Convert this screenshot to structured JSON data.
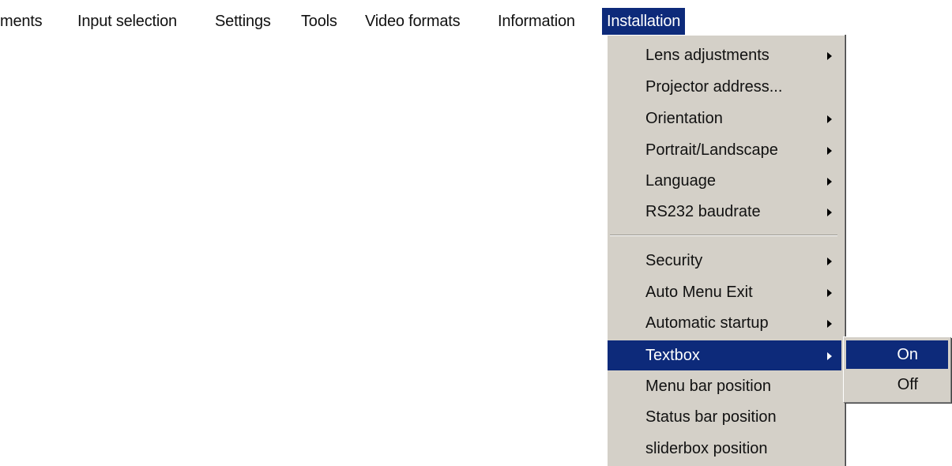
{
  "menubar": {
    "items": [
      {
        "label": "ments"
      },
      {
        "label": "Input selection"
      },
      {
        "label": "Settings"
      },
      {
        "label": "Tools"
      },
      {
        "label": "Video formats"
      },
      {
        "label": "Information"
      },
      {
        "label": "Installation"
      }
    ],
    "active_index": 6
  },
  "dropdown": {
    "items": [
      {
        "label": "Lens adjustments",
        "has_submenu": true
      },
      {
        "label": "Projector address...",
        "has_submenu": false
      },
      {
        "label": "Orientation",
        "has_submenu": true
      },
      {
        "label": "Portrait/Landscape",
        "has_submenu": true
      },
      {
        "label": "Language",
        "has_submenu": true
      },
      {
        "label": "RS232 baudrate",
        "has_submenu": true
      },
      {
        "label": "Security",
        "has_submenu": true
      },
      {
        "label": "Auto Menu Exit",
        "has_submenu": true
      },
      {
        "label": "Automatic startup",
        "has_submenu": true
      },
      {
        "label": "Textbox",
        "has_submenu": true,
        "selected": true
      },
      {
        "label": "Menu bar position",
        "has_submenu": false
      },
      {
        "label": "Status bar position",
        "has_submenu": false
      },
      {
        "label": "sliderbox position",
        "has_submenu": false
      }
    ]
  },
  "submenu": {
    "items": [
      {
        "label": "On",
        "selected": true
      },
      {
        "label": "Off",
        "selected": false
      }
    ]
  },
  "colors": {
    "highlight": "#0d2a7a",
    "menu_face": "#d4d0c8",
    "text": "#111111",
    "highlight_text": "#ffffff"
  },
  "icons": {
    "submenu_arrow": "chevron-right-icon"
  }
}
